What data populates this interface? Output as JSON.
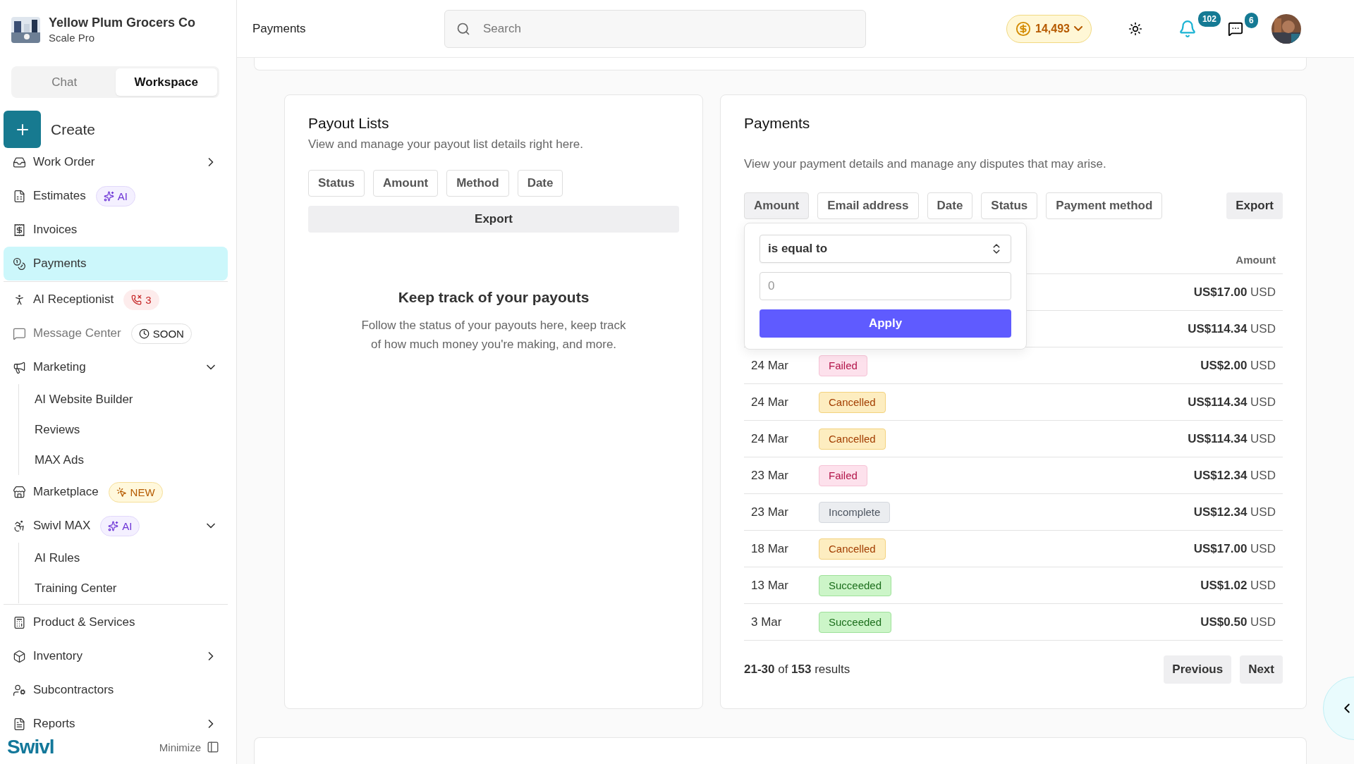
{
  "sidebar": {
    "company": {
      "name": "Yellow Plum Grocers Co",
      "plan": "Scale Pro"
    },
    "mode_tabs": [
      {
        "label": "Chat",
        "selected": false
      },
      {
        "label": "Workspace",
        "selected": true
      }
    ],
    "create": "Create",
    "sections": [
      [
        {
          "kind": "group",
          "label": "Work Order",
          "expanded": false,
          "selected": false,
          "disabled": false
        },
        {
          "kind": "link",
          "label": "Estimates",
          "badge": {
            "kind": "ai",
            "text": "AI"
          },
          "selected": false,
          "disabled": false
        },
        {
          "kind": "link",
          "label": "Invoices",
          "selected": false,
          "disabled": false
        },
        {
          "kind": "link",
          "label": "Payments",
          "selected": true,
          "disabled": false
        }
      ],
      [
        {
          "kind": "link",
          "label": "AI Receptionist",
          "badge": {
            "kind": "calls",
            "text": "3"
          },
          "selected": false,
          "disabled": false
        },
        {
          "kind": "link",
          "label": "Message Center",
          "badge": {
            "kind": "soon",
            "text": "SOON"
          },
          "selected": false,
          "disabled": true
        },
        {
          "kind": "group",
          "label": "Marketing",
          "expanded": true,
          "selected": false,
          "disabled": false,
          "children": [
            {
              "label": "AI Website Builder"
            },
            {
              "label": "Reviews"
            },
            {
              "label": "MAX Ads"
            }
          ]
        },
        {
          "kind": "link",
          "label": "Marketplace",
          "badge": {
            "kind": "new",
            "text": "NEW"
          },
          "selected": false,
          "disabled": false
        },
        {
          "kind": "group",
          "label": "Swivl MAX",
          "badge": {
            "kind": "ai",
            "text": "AI"
          },
          "expanded": true,
          "selected": false,
          "disabled": false,
          "children": [
            {
              "label": "AI Rules"
            },
            {
              "label": "Training Center"
            }
          ]
        }
      ],
      [
        {
          "kind": "link",
          "label": "Product & Services",
          "selected": false,
          "disabled": false
        },
        {
          "kind": "group",
          "label": "Inventory",
          "expanded": false,
          "selected": false,
          "disabled": false
        },
        {
          "kind": "link",
          "label": "Subcontractors",
          "selected": false,
          "disabled": false
        },
        {
          "kind": "group",
          "label": "Reports",
          "expanded": false,
          "selected": false,
          "disabled": false
        }
      ]
    ],
    "logo": "Swivl",
    "minimize": "Minimize"
  },
  "topbar": {
    "title": "Payments",
    "search": {
      "placeholder": "Search"
    },
    "coins": "14,493",
    "notifications": "102",
    "messages": "6"
  },
  "payout_lists": {
    "title": "Payout Lists",
    "subtitle": "View and manage your payout list details right here.",
    "filters": [
      {
        "label": "Status",
        "selected": false
      },
      {
        "label": "Amount",
        "selected": false
      },
      {
        "label": "Method",
        "selected": false
      },
      {
        "label": "Date",
        "selected": false
      }
    ],
    "export": "Export",
    "empty": {
      "title": "Keep track of your payouts",
      "text": "Follow the status of your payouts here, keep track of how much money you're making, and more."
    }
  },
  "payments": {
    "title": "Payments",
    "subtitle": "View your payment details and manage any disputes that may arise.",
    "filters": [
      {
        "label": "Amount",
        "selected": true
      },
      {
        "label": "Email address",
        "selected": false
      },
      {
        "label": "Date",
        "selected": false
      },
      {
        "label": "Status",
        "selected": false
      },
      {
        "label": "Payment method",
        "selected": false
      }
    ],
    "export": "Export",
    "filter_popover": {
      "operator": "is equal to",
      "value": {
        "placeholder": "0"
      },
      "apply": "Apply"
    },
    "columns": {
      "amount": "Amount"
    },
    "rows": [
      {
        "amount": "US$17.00",
        "currency": "USD"
      },
      {
        "amount": "US$114.34",
        "currency": "USD"
      },
      {
        "date": "24 Mar",
        "status": {
          "kind": "failed",
          "text": "Failed"
        },
        "amount": "US$2.00",
        "currency": "USD"
      },
      {
        "date": "24 Mar",
        "status": {
          "kind": "cancelled",
          "text": "Cancelled"
        },
        "amount": "US$114.34",
        "currency": "USD"
      },
      {
        "date": "24 Mar",
        "status": {
          "kind": "cancelled",
          "text": "Cancelled"
        },
        "amount": "US$114.34",
        "currency": "USD"
      },
      {
        "date": "23 Mar",
        "status": {
          "kind": "failed",
          "text": "Failed"
        },
        "amount": "US$12.34",
        "currency": "USD"
      },
      {
        "date": "23 Mar",
        "status": {
          "kind": "incomplete",
          "text": "Incomplete"
        },
        "amount": "US$12.34",
        "currency": "USD"
      },
      {
        "date": "18 Mar",
        "status": {
          "kind": "cancelled",
          "text": "Cancelled"
        },
        "amount": "US$17.00",
        "currency": "USD"
      },
      {
        "date": "13 Mar",
        "status": {
          "kind": "succeeded",
          "text": "Succeeded"
        },
        "amount": "US$1.02",
        "currency": "USD"
      },
      {
        "date": "3 Mar",
        "status": {
          "kind": "succeeded",
          "text": "Succeeded"
        },
        "amount": "US$0.50",
        "currency": "USD"
      }
    ],
    "summary": "**21-30** of **153** results",
    "pagination": [
      "Previous",
      "Next"
    ]
  }
}
